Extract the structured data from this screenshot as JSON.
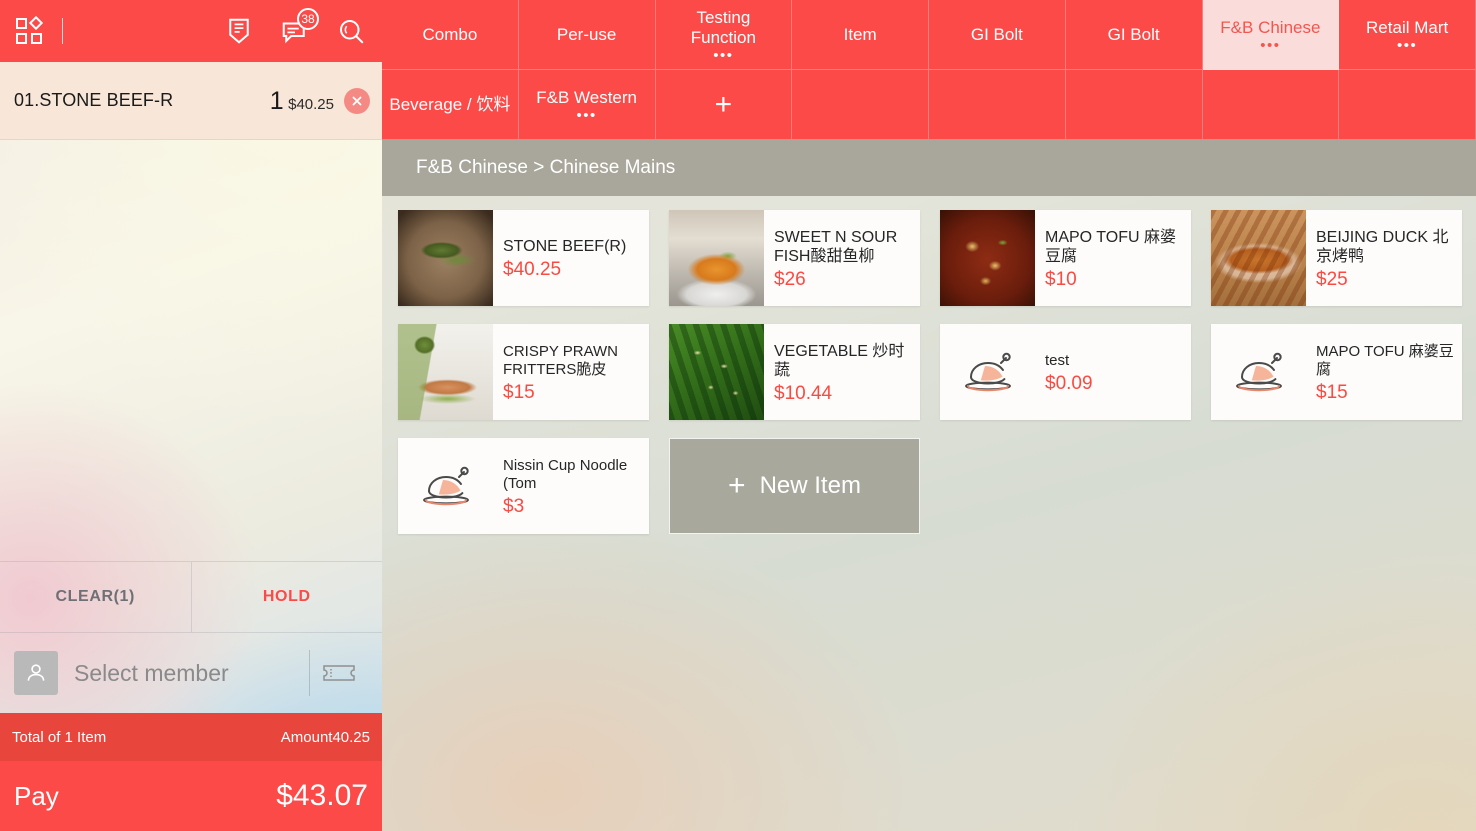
{
  "colors": {
    "brand_red": "#fc4a49",
    "totals_red": "#e8453c",
    "price_red": "#fb4a42",
    "active_tab_bg": "#fadcda",
    "breadcrumb_bg": "#a9a79b",
    "newitem_bg": "#a8a89c",
    "cart_row_bg": "#f8e7d9"
  },
  "header": {
    "apps_icon": "grid-apps-icon",
    "print_icon": "receipt-download-icon",
    "message_icon": "message-icon",
    "message_badge": "38",
    "search_icon": "search-icon"
  },
  "cart": {
    "items": [
      {
        "name": "01.STONE BEEF-R",
        "qty": "1",
        "price": "$40.25",
        "remove_icon": "close-circle-icon"
      }
    ],
    "clear_label": "CLEAR(1)",
    "hold_label": "HOLD",
    "member_placeholder": "Select member",
    "member_icon": "person-icon",
    "coupon_icon": "ticket-icon",
    "totals_left": "Total of 1 Item",
    "totals_right": "Amount40.25",
    "pay_label": "Pay",
    "pay_amount": "$43.07"
  },
  "tabs": {
    "row1": [
      {
        "label": "Combo",
        "active": false,
        "overflow": false
      },
      {
        "label": "Per-use",
        "active": false,
        "overflow": false
      },
      {
        "label": "Testing Function",
        "active": false,
        "overflow": true
      },
      {
        "label": "Item",
        "active": false,
        "overflow": false
      },
      {
        "label": "GI Bolt",
        "active": false,
        "overflow": false
      },
      {
        "label": "GI Bolt",
        "active": false,
        "overflow": false
      },
      {
        "label": "F&B Chinese",
        "active": true,
        "overflow": true
      },
      {
        "label": "Retail Mart",
        "active": false,
        "overflow": true
      }
    ],
    "row2": [
      {
        "label": "Beverage / 饮料",
        "active": false,
        "overflow": false
      },
      {
        "label": "F&B Western",
        "active": false,
        "overflow": true
      },
      {
        "label": "+",
        "active": false,
        "overflow": false,
        "is_plus": true
      },
      {
        "label": "",
        "active": false,
        "overflow": false,
        "blank": true
      },
      {
        "label": "",
        "active": false,
        "overflow": false,
        "blank": true
      },
      {
        "label": "",
        "active": false,
        "overflow": false,
        "blank": true
      },
      {
        "label": "",
        "active": false,
        "overflow": false,
        "blank": true
      },
      {
        "label": "",
        "active": false,
        "overflow": false,
        "blank": true
      }
    ],
    "overflow_dots": "•••"
  },
  "breadcrumb": "F&B Chinese > Chinese Mains",
  "products": {
    "rows": [
      [
        {
          "name": "STONE BEEF(R)",
          "price": "$40.25",
          "image": "stone-beef-photo",
          "photo_class": "ph-stonebeef"
        },
        {
          "name": "SWEET N SOUR FISH酸甜鱼柳",
          "price": "$26",
          "image": "sweet-sour-fish-photo",
          "photo_class": "ph-sweetsour"
        },
        {
          "name": "MAPO TOFU 麻婆豆腐",
          "price": "$10",
          "image": "mapo-tofu-photo",
          "photo_class": "ph-mapo"
        },
        {
          "name": "BEIJING DUCK 北京烤鸭",
          "price": "$25",
          "image": "beijing-duck-photo",
          "photo_class": "ph-duck"
        }
      ],
      [
        {
          "name": "CRISPY PRAWN FRITTERS脆皮",
          "price": "$15",
          "image": "crispy-prawn-photo",
          "photo_class": "ph-prawn",
          "small": true
        },
        {
          "name": "VEGETABLE 炒时蔬",
          "price": "$10.44",
          "image": "vegetable-photo",
          "photo_class": "ph-veg"
        },
        {
          "name": "test",
          "price": "$0.09",
          "image": "roast-chicken-placeholder-icon",
          "placeholder": true,
          "small": true
        },
        {
          "name": "MAPO TOFU 麻婆豆腐",
          "price": "$15",
          "image": "roast-chicken-placeholder-icon",
          "placeholder": true,
          "small": true
        }
      ],
      [
        {
          "name": "Nissin Cup Noodle (Tom",
          "price": "$3",
          "image": "roast-chicken-placeholder-icon",
          "placeholder": true,
          "small": true
        }
      ]
    ],
    "new_item_label": "New Item",
    "new_item_plus": "+"
  }
}
